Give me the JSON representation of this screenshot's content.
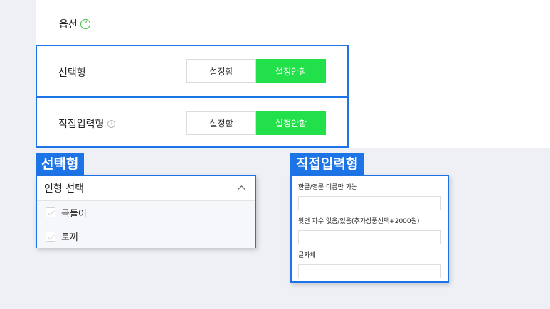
{
  "option_header": {
    "label": "옵션",
    "help_icon": "question-circle-icon"
  },
  "rows": [
    {
      "label": "선택형",
      "on_label": "설정함",
      "off_label": "설정안함",
      "selected": "설정안함"
    },
    {
      "label": "직접입력형",
      "info_icon": "info-circle-icon",
      "on_label": "설정함",
      "off_label": "설정안함",
      "selected": "설정안함"
    }
  ],
  "select_card": {
    "tag": "선택형",
    "title": "인형 선택",
    "items": [
      {
        "label": "곰돌이"
      },
      {
        "label": "토끼"
      }
    ]
  },
  "input_card": {
    "tag": "직접입력형",
    "fields": [
      {
        "label": "한글/영문 이름만 가능",
        "value": ""
      },
      {
        "label": "뒷면 자수 없음/있음(추가상품선택+2000원)",
        "value": ""
      },
      {
        "label": "글자체",
        "value": ""
      }
    ]
  },
  "colors": {
    "accent": "#1d74e6",
    "active": "#22e04a",
    "help": "#3fbf3f"
  }
}
